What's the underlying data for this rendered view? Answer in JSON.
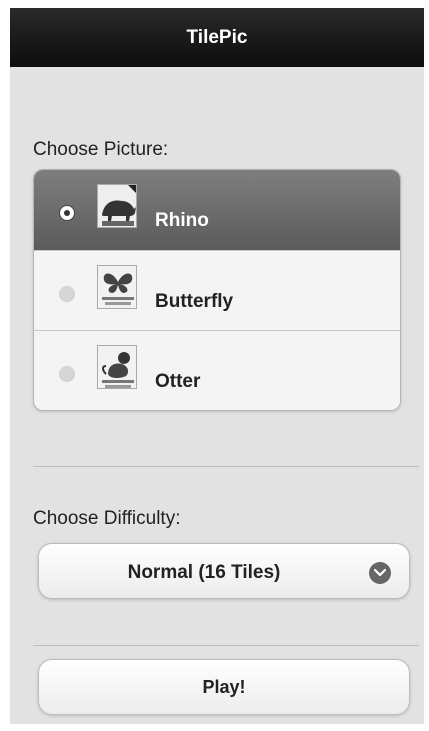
{
  "header": {
    "title": "TilePic"
  },
  "picture_section": {
    "label": "Choose Picture:",
    "items": [
      {
        "label": "Rhino",
        "selected": true,
        "icon": "rhino-icon"
      },
      {
        "label": "Butterfly",
        "selected": false,
        "icon": "butterfly-icon"
      },
      {
        "label": "Otter",
        "selected": false,
        "icon": "otter-icon"
      }
    ]
  },
  "difficulty_section": {
    "label": "Choose Difficulty:",
    "selected_value": "Normal (16 Tiles)"
  },
  "play_button": {
    "label": "Play!"
  }
}
